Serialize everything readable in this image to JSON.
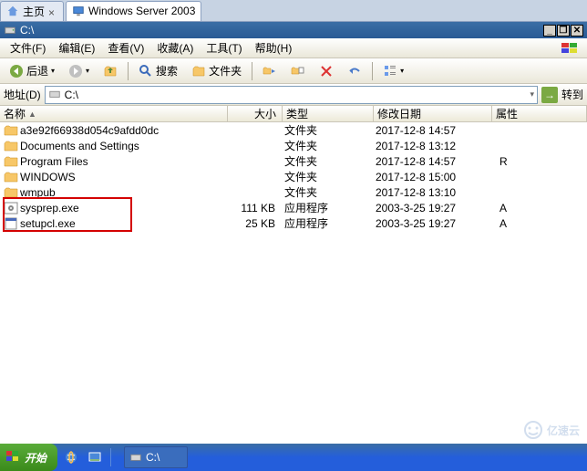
{
  "browser_tabs": [
    {
      "label": "主页",
      "icon": "home"
    },
    {
      "label": "Windows Server 2003",
      "icon": "monitor"
    }
  ],
  "vm": {
    "title": "C:\\"
  },
  "menubar": [
    {
      "label": "文件(F)"
    },
    {
      "label": "编辑(E)"
    },
    {
      "label": "查看(V)"
    },
    {
      "label": "收藏(A)"
    },
    {
      "label": "工具(T)"
    },
    {
      "label": "帮助(H)"
    }
  ],
  "toolbar": {
    "back": "后退",
    "search": "搜索",
    "folders": "文件夹"
  },
  "addressbar": {
    "label": "地址(D)",
    "path": "C:\\",
    "go": "转到"
  },
  "columns": {
    "name": "名称",
    "size": "大小",
    "type": "类型",
    "date": "修改日期",
    "attr": "属性"
  },
  "files": [
    {
      "icon": "folder",
      "name": "a3e92f66938d054c9afdd0dc",
      "size": "",
      "type": "文件夹",
      "date": "2017-12-8 14:57",
      "attr": ""
    },
    {
      "icon": "folder",
      "name": "Documents and Settings",
      "size": "",
      "type": "文件夹",
      "date": "2017-12-8 13:12",
      "attr": ""
    },
    {
      "icon": "folder",
      "name": "Program Files",
      "size": "",
      "type": "文件夹",
      "date": "2017-12-8 14:57",
      "attr": "R"
    },
    {
      "icon": "folder",
      "name": "WINDOWS",
      "size": "",
      "type": "文件夹",
      "date": "2017-12-8 15:00",
      "attr": ""
    },
    {
      "icon": "folder",
      "name": "wmpub",
      "size": "",
      "type": "文件夹",
      "date": "2017-12-8 13:10",
      "attr": ""
    },
    {
      "icon": "exe-gear",
      "name": "sysprep.exe",
      "size": "111 KB",
      "type": "应用程序",
      "date": "2003-3-25 19:27",
      "attr": "A"
    },
    {
      "icon": "exe-blank",
      "name": "setupcl.exe",
      "size": "25 KB",
      "type": "应用程序",
      "date": "2003-3-25 19:27",
      "attr": "A"
    }
  ],
  "taskbar": {
    "start": "开始",
    "task_label": "C:\\"
  },
  "watermark": "亿速云"
}
